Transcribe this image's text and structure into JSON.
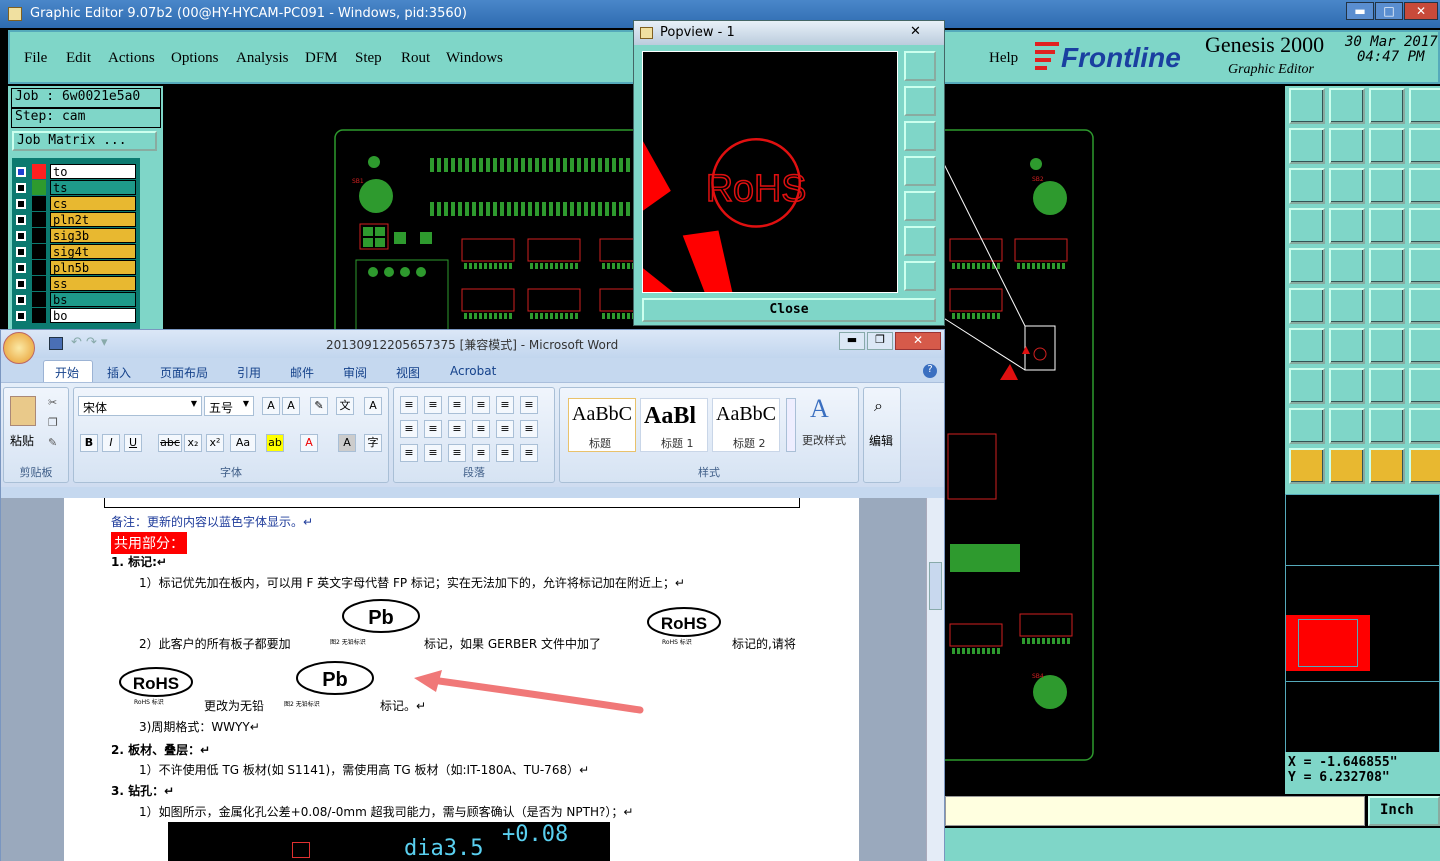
{
  "genesis": {
    "title": "Graphic Editor 9.07b2 (00@HY-HYCAM-PC091 - Windows, pid:3560)",
    "menu": [
      "File",
      "Edit",
      "Actions",
      "Options",
      "Analysis",
      "DFM",
      "Step",
      "Rout",
      "Windows"
    ],
    "help": "Help",
    "brand": "Frontline",
    "product": "Genesis 2000",
    "subtitle": "Graphic Editor",
    "date": "30 Mar 2017",
    "time": "04:47 PM",
    "job": "Job : 6w0021e5a0",
    "step": "Step: cam",
    "job_matrix": "Job Matrix ...",
    "layers": [
      {
        "name": "to",
        "color": "#ff2020",
        "bg": "#ffffff"
      },
      {
        "name": "ts",
        "color": "#2e9a2e",
        "bg": "#1e9a8a"
      },
      {
        "name": "cs",
        "color": "#000000",
        "bg": "#e8b830"
      },
      {
        "name": "pln2t",
        "color": "#000000",
        "bg": "#e8b830"
      },
      {
        "name": "sig3b",
        "color": "#000000",
        "bg": "#e8b830"
      },
      {
        "name": "sig4t",
        "color": "#000000",
        "bg": "#e8b830"
      },
      {
        "name": "pln5b",
        "color": "#000000",
        "bg": "#e8b830"
      },
      {
        "name": "ss",
        "color": "#000000",
        "bg": "#e8b830"
      },
      {
        "name": "bs",
        "color": "#000000",
        "bg": "#1e9a8a"
      },
      {
        "name": "bo",
        "color": "#000000",
        "bg": "#ffffff"
      }
    ],
    "coords": {
      "x": "X = -1.646855\"",
      "y": "Y =  6.232708\""
    },
    "unit": "Inch",
    "board_labels": [
      "SB1",
      "SB2",
      "SB4"
    ]
  },
  "popview": {
    "title": "Popview - 1",
    "logo_text": "RoHS",
    "close": "Close"
  },
  "word": {
    "title": "20130912205657375 [兼容模式] - Microsoft Word",
    "tabs": [
      "开始",
      "插入",
      "页面布局",
      "引用",
      "邮件",
      "审阅",
      "视图",
      "Acrobat"
    ],
    "clipboard": {
      "paste": "粘贴",
      "group": "剪贴板"
    },
    "font": {
      "name": "宋体",
      "size": "五号",
      "group": "字体"
    },
    "paragraph_group": "段落",
    "styles": [
      {
        "sample": "AaBbC",
        "name": "标题"
      },
      {
        "sample": "AaBl",
        "name": "标题 1"
      },
      {
        "sample": "AaBbC",
        "name": "标题 2"
      }
    ],
    "styles_group": "样式",
    "change_styles": "更改样式",
    "edit": "编辑",
    "doc": {
      "note": "备注：更新的内容以蓝色字体显示。↵",
      "heading": "共用部分：",
      "s1": "1.   标记:↵",
      "s1_1": "1）标记优先加在板内，可以用 F 英文字母代替 FP 标记；实在无法加下的，允许将标记加在附近上；↵",
      "s1_2a": "2）此客户的所有板子都要加",
      "s1_2b": "标记，如果  GERBER 文件中加了",
      "s1_2c": "标记的,请将",
      "s1_2d": "更改为无铅",
      "s1_2e": "标记。↵",
      "pb": "Pb",
      "pb_caption": "图2   无铅标识",
      "rohs": "RoHS",
      "rohs_caption": "RoHS 标识",
      "s1_3": "3)周期格式：WWYY↵",
      "s2": "2.   板材、叠层：↵",
      "s2_1": "1）不许使用低 TG 板材(如 S1141)，需使用高 TG 板材（如:IT-180A、TU-768）↵",
      "s3": "3.   钻孔：↵",
      "s3_1": "1）如图所示，金属化孔公差+0.08/-0mm 超我司能力，需与顾客确认（是否为 NPTH?）；↵",
      "img_text": "dia3.5",
      "img_tol": "+0.08"
    }
  }
}
